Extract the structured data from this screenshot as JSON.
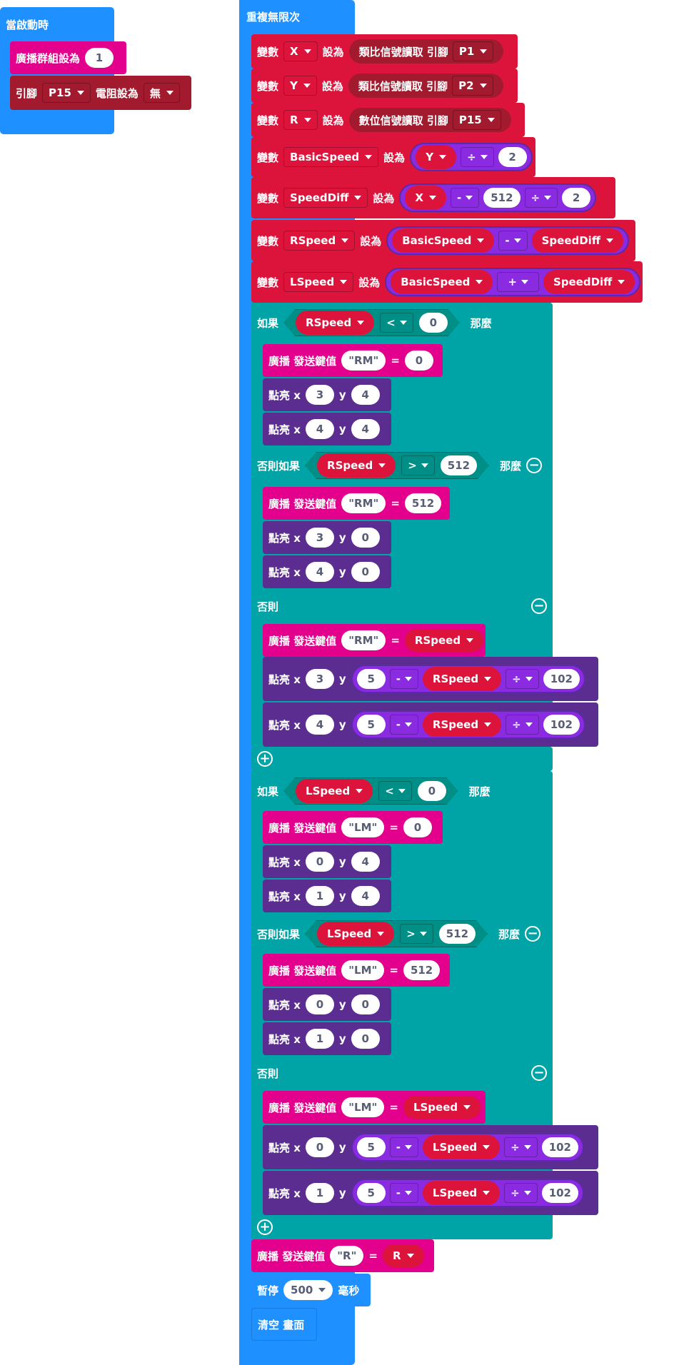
{
  "start": {
    "title": "當啟動時",
    "radio_group_label": "廣播群組設為",
    "radio_group": "1",
    "pin_label": "引腳",
    "pin": "P15",
    "resistor_label": "電阻設為",
    "resistor": "無"
  },
  "forever": {
    "title": "重複無限次"
  },
  "words": {
    "var": "變數",
    "set": "設為",
    "analog": "類比信號讀取 引腳",
    "digital": "數位信號讀取 引腳",
    "if": "如果",
    "elseif": "否則如果",
    "else": "否則",
    "then": "那麼",
    "send": "廣播 發送鍵值",
    "plot": "點亮 x",
    "y": "y",
    "pause": "暫停",
    "ms": "毫秒",
    "clear": "清空 畫面",
    "eq": "="
  },
  "vars": {
    "x": "X",
    "y": "Y",
    "r": "R",
    "basic": "BasicSpeed",
    "diff": "SpeedDiff",
    "rspeed": "RSpeed",
    "lspeed": "LSpeed"
  },
  "pins": {
    "p1": "P1",
    "p2": "P2",
    "p15": "P15"
  },
  "ops": {
    "div": "÷",
    "minus": "-",
    "plus": "+",
    "lt": "<",
    "gt": ">"
  },
  "nums": {
    "n0": "0",
    "n1": "1",
    "n2": "2",
    "n3": "3",
    "n4": "4",
    "n5": "5",
    "n102": "102",
    "n512": "512",
    "n500": "500"
  },
  "keys": {
    "rm": "\"RM\"",
    "lm": "\"LM\"",
    "r": "\"R\""
  }
}
